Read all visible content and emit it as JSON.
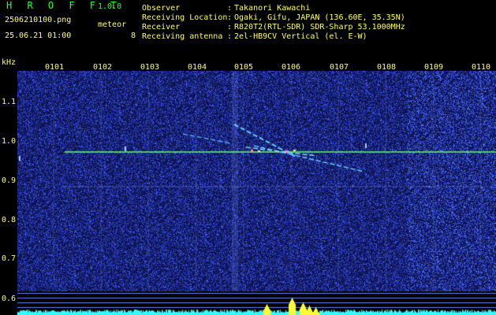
{
  "header": {
    "app_title": "H R O F F T",
    "app_version": "1.0.0",
    "file_name": "2506210100.png",
    "meteor_label": "meteor",
    "datetime": "25.06.21 01:00",
    "meteor_count": "8",
    "info": [
      {
        "label": "Observer",
        "value": "Takanori Kawachi"
      },
      {
        "label": "Receiving Location",
        "value": "Ogaki, Gifu, JAPAN (136.60E, 35.35N)"
      },
      {
        "label": "Receiver",
        "value": "R820T2(RTL-SDR) SDR-Sharp 53.1000MHz"
      },
      {
        "label": "Receiving antenna",
        "value": "2el-HB9CV Vertical (el. E-W)"
      }
    ],
    "separator": ":"
  },
  "axis": {
    "unit": "kHz",
    "y_ticks": [
      "1.1",
      "1.0",
      "0.9",
      "0.8",
      "0.7",
      "0.6"
    ],
    "x_ticks": [
      "0101",
      "0102",
      "0103",
      "0104",
      "0105",
      "0106",
      "0107",
      "0108",
      "0109",
      "0110"
    ]
  },
  "colors": {
    "text": "#ffff66",
    "title": "#33ff33",
    "background": "#000000",
    "noise": "#1a2a9a",
    "carrier": "#66ff66",
    "power": "#33ffff",
    "power_peak": "#ffff33"
  }
}
